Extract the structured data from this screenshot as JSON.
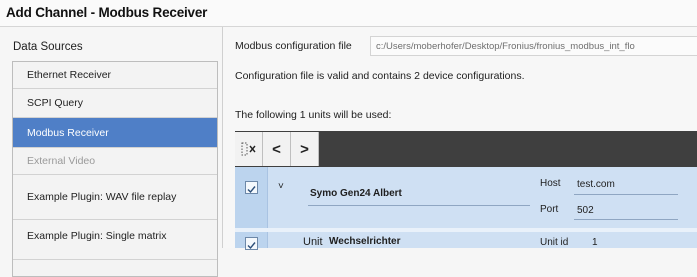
{
  "window": {
    "title": "Add Channel - Modbus Receiver"
  },
  "data_sources": {
    "heading": "Data Sources",
    "items": [
      {
        "label": "Ethernet Receiver",
        "state": "normal"
      },
      {
        "label": "SCPI Query",
        "state": "normal"
      },
      {
        "label": "Modbus Receiver",
        "state": "selected"
      },
      {
        "label": "External Video",
        "state": "disabled"
      },
      {
        "label": "Example Plugin: WAV file replay",
        "state": "normal"
      },
      {
        "label": "Example Plugin: Single matrix",
        "state": "normal"
      }
    ]
  },
  "config": {
    "label": "Modbus configuration file",
    "path": "c:/Users/moberhofer/Desktop/Fronius/fronius_modbus_int_flo",
    "status": "Configuration file is valid and contains 2 device configurations.",
    "units_label": "The following 1 units will be used:"
  },
  "toolbar": {
    "clear_icon": "clear-selection-icon",
    "collapse_icon": "chevron-left-icon",
    "expand_icon": "chevron-right-icon",
    "collapse_glyph": "<",
    "expand_glyph": ">"
  },
  "devices": [
    {
      "name": "Symo Gen24 Albert",
      "expand_glyph": "˅",
      "host_label": "Host",
      "host_value": "test.com",
      "port_label": "Port",
      "port_value": "502",
      "units": [
        {
          "prefix": "Unit",
          "name": "Wechselrichter",
          "id_label": "Unit id",
          "id_value": "1"
        }
      ]
    }
  ],
  "colors": {
    "selected_bg": "#4f7fc7",
    "grid_bg": "#cfe0f3",
    "toolbar_bg": "#3f3f3f"
  }
}
